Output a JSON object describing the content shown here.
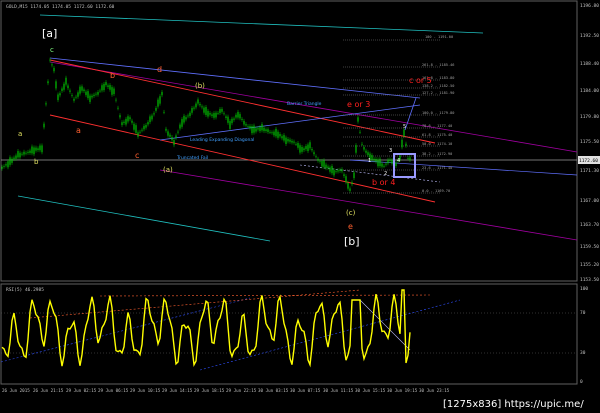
{
  "main_header": "GOLD,M15  1174.05 1174.05 1172.60 1172.60",
  "rsi_header": "RSI(5) 46.2985",
  "watermark": "[1275x836] https://upic.me/",
  "price_axis": {
    "labels": [
      "1196.80",
      "1192.50",
      "1188.40",
      "1184.00",
      "1179.80",
      "1175.50",
      "1171.30",
      "1167.00",
      "1163.70",
      "1159.50",
      "1155.20",
      "1153.50"
    ],
    "current_price": "1172.60"
  },
  "rsi_axis": {
    "labels": [
      "100",
      "70",
      "30",
      "0"
    ]
  },
  "time_axis": {
    "labels": [
      "26 Jun 2015",
      "26 Jun 21:15",
      "29 Jun 02:15",
      "29 Jun 06:15",
      "29 Jun 10:15",
      "29 Jun 14:15",
      "29 Jun 18:15",
      "29 Jun 22:15",
      "30 Jun 03:15",
      "30 Jun 07:15",
      "30 Jun 11:15",
      "30 Jun 15:15",
      "30 Jun 19:15",
      "30 Jun 23:15"
    ]
  },
  "wave_labels": {
    "a_bracket": "[a]",
    "b_bracket": "[b]",
    "c_green": "c",
    "a_yellow": "a",
    "b_yellow": "b",
    "a_orange": "a",
    "b_orange": "b",
    "c_orange": "c",
    "d_orange": "d",
    "b_paren": "(b)",
    "a_paren": "(a)",
    "c_paren": "(c)",
    "e_orange": "e",
    "e_or_3": "e or 3",
    "c_or_5": "c or 5",
    "b_or_4": "b or 4",
    "w1": "1",
    "w2": "2",
    "w3": "3",
    "w4": "4",
    "w5": "5"
  },
  "annotations": {
    "barrier_triangle": "Barrier Triangle",
    "leading_diagonal": "Leading Expanding Diagonal",
    "truncated_fail": "Truncated Fail"
  },
  "fib_levels": [
    "100 - 1191.00",
    "261.8 - 1185.46",
    "161.8 - 1183.80",
    "138.2 - 1182.50",
    "127.2 - 1181.90",
    "100.0 - 1179.80",
    "78.6 - 1177.40",
    "61.8 - 1175.40",
    "50.0 - 1174.10",
    "38.2 - 1172.90",
    "23.6 - 1171.40",
    "0.0 - 1169.70"
  ],
  "colors": {
    "background": "#000000",
    "candles": "#00c800",
    "rsi": "#ffff00",
    "fib": "#808080",
    "channel": "#ff4040",
    "highlight_box": "#9999ff"
  }
}
